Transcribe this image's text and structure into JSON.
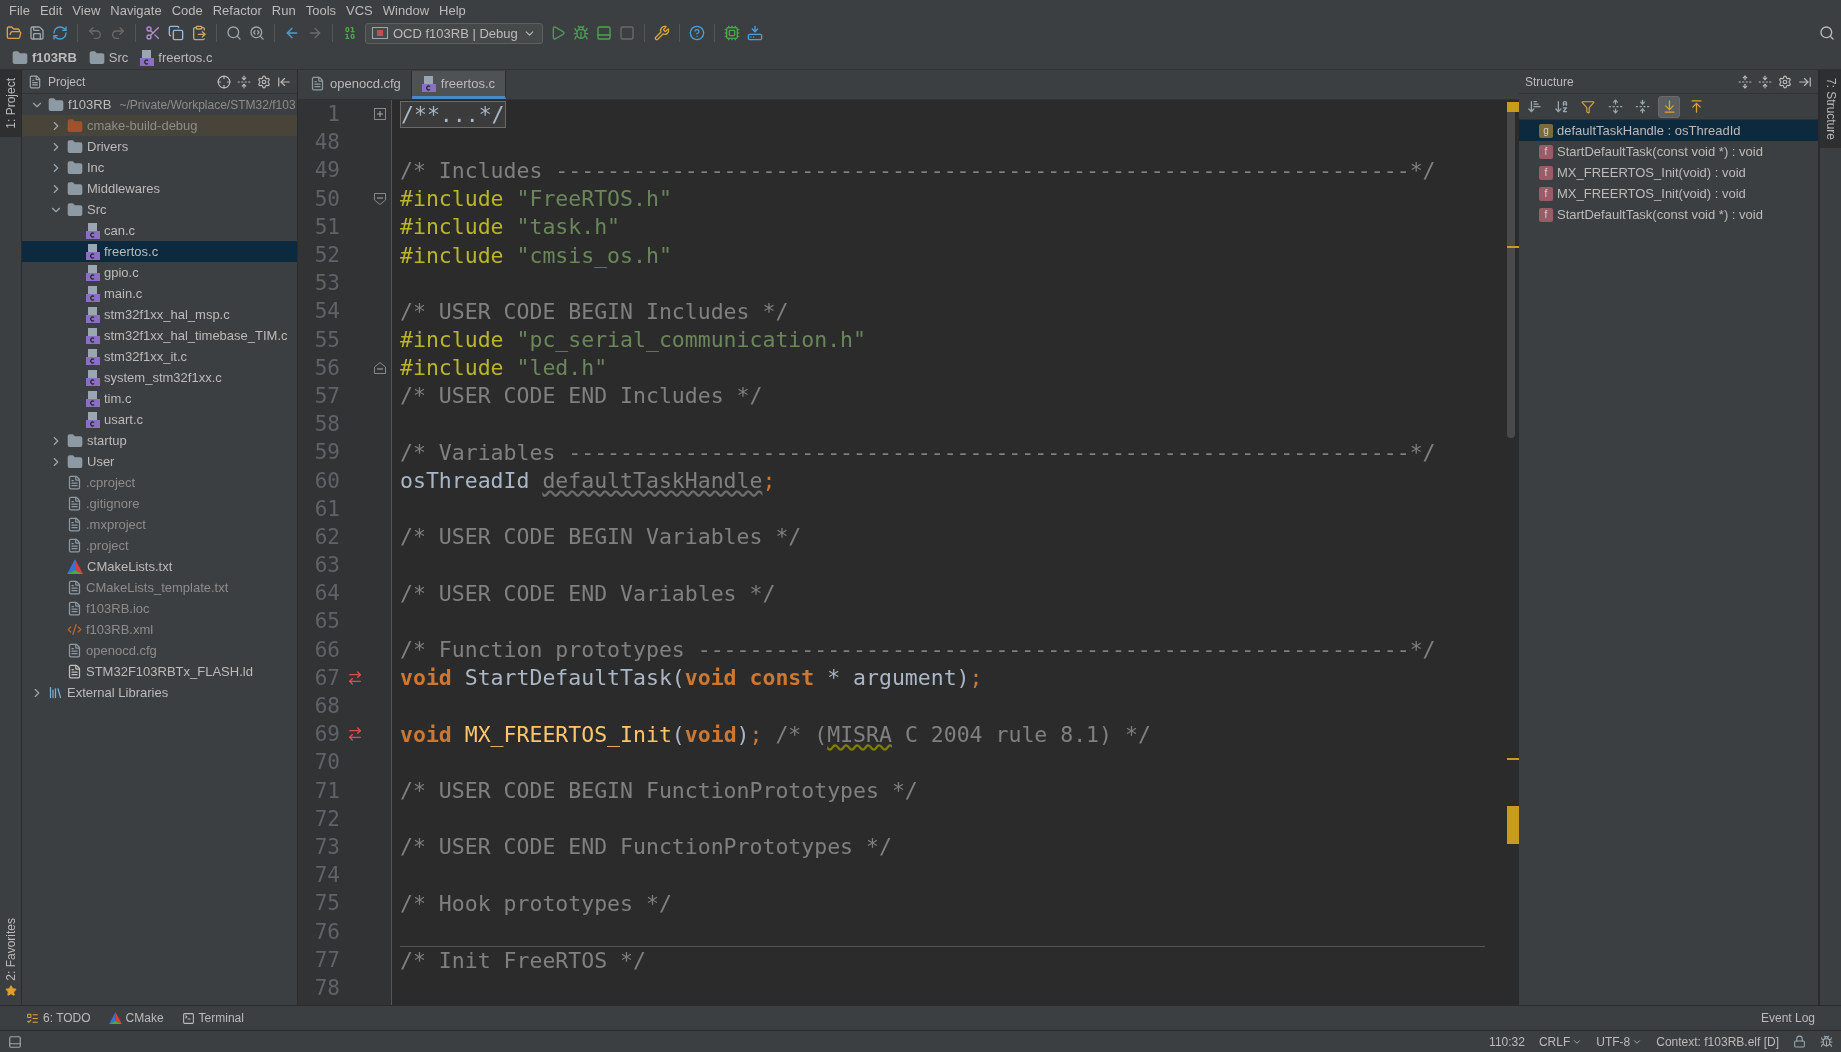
{
  "menu": [
    "File",
    "Edit",
    "View",
    "Navigate",
    "Code",
    "Refactor",
    "Run",
    "Tools",
    "VCS",
    "Window",
    "Help"
  ],
  "toolbar": {
    "run_config": "OCD f103RB | Debug"
  },
  "breadcrumbs": [
    {
      "label": "f103RB",
      "kind": "folder"
    },
    {
      "label": "Src",
      "kind": "folder"
    },
    {
      "label": "freertos.c",
      "kind": "cfile"
    }
  ],
  "left_stripe": {
    "top": "1: Project",
    "bottom": "2: Favorites"
  },
  "project": {
    "title": "Project",
    "tree": [
      {
        "label": "f103RB",
        "path": "~/Private/Workplace/STM32/f103",
        "kind": "folder",
        "expanded": true,
        "selected": false,
        "children": [
          {
            "label": "cmake-build-debug",
            "kind": "excluded",
            "expanded": false,
            "selected": false
          },
          {
            "label": "Drivers",
            "kind": "folder",
            "expanded": false,
            "selected": false
          },
          {
            "label": "Inc",
            "kind": "folder",
            "expanded": false,
            "selected": false
          },
          {
            "label": "Middlewares",
            "kind": "folder",
            "expanded": false,
            "selected": false
          },
          {
            "label": "Src",
            "kind": "folder",
            "expanded": true,
            "selected": false,
            "children": [
              {
                "label": "can.c",
                "kind": "cfile",
                "selected": false
              },
              {
                "label": "freertos.c",
                "kind": "cfile",
                "selected": true
              },
              {
                "label": "gpio.c",
                "kind": "cfile",
                "selected": false
              },
              {
                "label": "main.c",
                "kind": "cfile",
                "selected": false
              },
              {
                "label": "stm32f1xx_hal_msp.c",
                "kind": "cfile",
                "selected": false
              },
              {
                "label": "stm32f1xx_hal_timebase_TIM.c",
                "kind": "cfile",
                "selected": false
              },
              {
                "label": "stm32f1xx_it.c",
                "kind": "cfile",
                "selected": false
              },
              {
                "label": "system_stm32f1xx.c",
                "kind": "cfile",
                "selected": false
              },
              {
                "label": "tim.c",
                "kind": "cfile",
                "selected": false
              },
              {
                "label": "usart.c",
                "kind": "cfile",
                "selected": false
              }
            ]
          },
          {
            "label": "startup",
            "kind": "folder",
            "expanded": false,
            "selected": false
          },
          {
            "label": "User",
            "kind": "folder",
            "expanded": false,
            "selected": false
          },
          {
            "label": ".cproject",
            "kind": "file",
            "selected": false
          },
          {
            "label": ".gitignore",
            "kind": "file",
            "selected": false
          },
          {
            "label": ".mxproject",
            "kind": "file",
            "selected": false
          },
          {
            "label": ".project",
            "kind": "file",
            "selected": false
          },
          {
            "label": "CMakeLists.txt",
            "kind": "cmake",
            "selected": false
          },
          {
            "label": "CMakeLists_template.txt",
            "kind": "file",
            "selected": false
          },
          {
            "label": "f103RB.ioc",
            "kind": "file",
            "selected": false
          },
          {
            "label": "f103RB.xml",
            "kind": "xml",
            "selected": false
          },
          {
            "label": "openocd.cfg",
            "kind": "file",
            "selected": false
          },
          {
            "label": "STM32F103RBTx_FLASH.ld",
            "kind": "ldfile",
            "selected": false
          }
        ]
      },
      {
        "label": "External Libraries",
        "kind": "library",
        "expanded": false,
        "selected": false
      }
    ]
  },
  "tabs": [
    {
      "label": "openocd.cfg",
      "kind": "file",
      "selected": false
    },
    {
      "label": "freertos.c",
      "kind": "cfile",
      "selected": true
    }
  ],
  "code": [
    {
      "number": "1",
      "kind": "fold-collapsed",
      "separator": false,
      "segments": [
        {
          "kind": "folded",
          "text": "/**...*/"
        }
      ]
    },
    {
      "number": "48",
      "kind": "plain",
      "separator": false
    },
    {
      "number": "49",
      "kind": "plain",
      "separator": false,
      "segments": [
        {
          "kind": "comment",
          "text": "/* Includes ------------------------------------------------------------------*/"
        }
      ]
    },
    {
      "number": "50",
      "kind": "fold-start",
      "separator": false,
      "segments": [
        {
          "kind": "directive",
          "text": "#include"
        },
        {
          "kind": "string",
          "text": " \"FreeRTOS.h\""
        }
      ]
    },
    {
      "number": "51",
      "kind": "plain",
      "separator": false,
      "segments": [
        {
          "kind": "directive",
          "text": "#include"
        },
        {
          "kind": "string",
          "text": " \"task.h\""
        }
      ]
    },
    {
      "number": "52",
      "kind": "plain",
      "separator": false,
      "segments": [
        {
          "kind": "directive",
          "text": "#include"
        },
        {
          "kind": "string",
          "text": " \"cmsis_os.h\""
        }
      ]
    },
    {
      "number": "53",
      "kind": "plain",
      "separator": false
    },
    {
      "number": "54",
      "kind": "plain",
      "separator": false,
      "segments": [
        {
          "kind": "comment",
          "text": "/* USER CODE BEGIN Includes */"
        }
      ]
    },
    {
      "number": "55",
      "kind": "plain",
      "separator": false,
      "segments": [
        {
          "kind": "directive",
          "text": "#include"
        },
        {
          "kind": "string",
          "text": " \"pc_serial_communication.h\""
        }
      ]
    },
    {
      "number": "56",
      "kind": "fold-end",
      "separator": false,
      "segments": [
        {
          "kind": "directive",
          "text": "#include"
        },
        {
          "kind": "string",
          "text": " \"led.h\""
        }
      ]
    },
    {
      "number": "57",
      "kind": "plain",
      "separator": false,
      "segments": [
        {
          "kind": "comment",
          "text": "/* USER CODE END Includes */"
        }
      ]
    },
    {
      "number": "58",
      "kind": "plain",
      "separator": false
    },
    {
      "number": "59",
      "kind": "plain",
      "separator": false,
      "segments": [
        {
          "kind": "comment",
          "text": "/* Variables -----------------------------------------------------------------*/"
        }
      ]
    },
    {
      "number": "60",
      "kind": "plain",
      "separator": false,
      "segments": [
        {
          "kind": "plain",
          "text": "osThreadId "
        },
        {
          "kind": "unused",
          "text": "defaultTaskHandle"
        },
        {
          "kind": "punct",
          "text": ";"
        }
      ]
    },
    {
      "number": "61",
      "kind": "plain",
      "separator": false
    },
    {
      "number": "62",
      "kind": "plain",
      "separator": false,
      "segments": [
        {
          "kind": "comment",
          "text": "/* USER CODE BEGIN Variables */"
        }
      ]
    },
    {
      "number": "63",
      "kind": "plain",
      "separator": false
    },
    {
      "number": "64",
      "kind": "plain",
      "separator": false,
      "segments": [
        {
          "kind": "comment",
          "text": "/* USER CODE END Variables */"
        }
      ]
    },
    {
      "number": "65",
      "kind": "plain",
      "separator": false
    },
    {
      "number": "66",
      "kind": "plain",
      "separator": false,
      "segments": [
        {
          "kind": "comment",
          "text": "/* Function prototypes -------------------------------------------------------*/"
        }
      ]
    },
    {
      "number": "67",
      "kind": "implemented",
      "separator": false,
      "segments": [
        {
          "kind": "keyword",
          "text": "void"
        },
        {
          "kind": "plain",
          "text": " StartDefaultTask("
        },
        {
          "kind": "keyword",
          "text": "void const"
        },
        {
          "kind": "plain",
          "text": " * argument)"
        },
        {
          "kind": "punct",
          "text": ";"
        }
      ]
    },
    {
      "number": "68",
      "kind": "plain",
      "separator": false
    },
    {
      "number": "69",
      "kind": "implemented",
      "separator": false,
      "segments": [
        {
          "kind": "keyword",
          "text": "void"
        },
        {
          "kind": "func",
          "text": " MX_FREERTOS_Init"
        },
        {
          "kind": "plain",
          "text": "("
        },
        {
          "kind": "keyword",
          "text": "void"
        },
        {
          "kind": "plain",
          "text": ")"
        },
        {
          "kind": "punct",
          "text": ";"
        },
        {
          "kind": "comment",
          "text": " /* ("
        },
        {
          "kind": "comment-warning",
          "text": "MISRA"
        },
        {
          "kind": "comment",
          "text": " C 2004 rule 8.1) */"
        }
      ]
    },
    {
      "number": "70",
      "kind": "plain",
      "separator": false
    },
    {
      "number": "71",
      "kind": "plain",
      "separator": false,
      "segments": [
        {
          "kind": "comment",
          "text": "/* USER CODE BEGIN FunctionPrototypes */"
        }
      ]
    },
    {
      "number": "72",
      "kind": "plain",
      "separator": false
    },
    {
      "number": "73",
      "kind": "plain",
      "separator": false,
      "segments": [
        {
          "kind": "comment",
          "text": "/* USER CODE END FunctionPrototypes */"
        }
      ]
    },
    {
      "number": "74",
      "kind": "plain",
      "separator": false
    },
    {
      "number": "75",
      "kind": "plain",
      "separator": false,
      "segments": [
        {
          "kind": "comment",
          "text": "/* Hook prototypes */"
        }
      ]
    },
    {
      "number": "76",
      "kind": "plain",
      "separator": false
    },
    {
      "number": "77",
      "kind": "plain",
      "separator": true,
      "segments": [
        {
          "kind": "comment",
          "text": "/* Init FreeRTOS */"
        }
      ]
    },
    {
      "number": "78",
      "kind": "plain",
      "separator": false
    }
  ],
  "structure": {
    "title": "Structure",
    "toggles": [
      {
        "kind": "sort-visibility",
        "selected": false
      },
      {
        "kind": "sort-alpha",
        "selected": false
      },
      {
        "kind": "filter",
        "selected": false
      },
      {
        "kind": "expand",
        "selected": false
      },
      {
        "kind": "collapse",
        "selected": false
      },
      {
        "kind": "autoscroll-to",
        "selected": true
      },
      {
        "kind": "autoscroll-from",
        "selected": false
      }
    ],
    "items": [
      {
        "badge": "g",
        "kind": "variable",
        "label": "defaultTaskHandle : osThreadId",
        "selected": true
      },
      {
        "badge": "f",
        "kind": "function",
        "label": "StartDefaultTask(const void *) : void",
        "selected": false
      },
      {
        "badge": "f",
        "kind": "function",
        "label": "MX_FREERTOS_Init(void) : void",
        "selected": false
      },
      {
        "badge": "f",
        "kind": "function",
        "label": "MX_FREERTOS_Init(void) : void",
        "selected": false
      },
      {
        "badge": "f",
        "kind": "function",
        "label": "StartDefaultTask(const void *) : void",
        "selected": false
      }
    ]
  },
  "right_stripe": "7: Structure",
  "bottom_tools": [
    {
      "label": "6: TODO",
      "kind": "todo"
    },
    {
      "label": "CMake",
      "kind": "cmake"
    },
    {
      "label": "Terminal",
      "kind": "terminal"
    }
  ],
  "event_log": "Event Log",
  "status_bar": {
    "position": "110:32",
    "line_separator": "CRLF",
    "encoding": "UTF-8",
    "context": "Context: f103RB.elf [D]"
  }
}
